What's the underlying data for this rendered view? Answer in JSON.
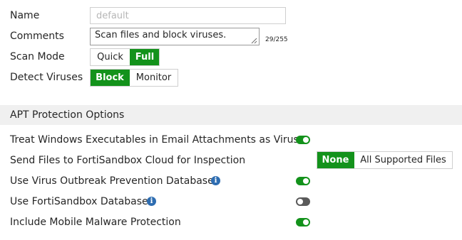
{
  "form": {
    "name_label": "Name",
    "name_placeholder": "default",
    "comments_label": "Comments",
    "comments_value": "Scan files and block viruses.",
    "comments_counter": "29/255",
    "scan_mode_label": "Scan Mode",
    "scan_mode_options": [
      "Quick",
      "Full"
    ],
    "scan_mode_selected": "Full",
    "detect_viruses_label": "Detect Viruses",
    "detect_viruses_options": [
      "Block",
      "Monitor"
    ],
    "detect_viruses_selected": "Block"
  },
  "apt": {
    "section_title": "APT Protection Options",
    "treat_exec_label": "Treat Windows Executables in Email Attachments as Viruses",
    "treat_exec_enabled": true,
    "send_sandbox_label": "Send Files to FortiSandbox Cloud for Inspection",
    "send_sandbox_options": [
      "None",
      "All Supported Files"
    ],
    "send_sandbox_selected": "None",
    "outbreak_db_label": "Use Virus Outbreak Prevention Database",
    "outbreak_db_enabled": true,
    "fortisandbox_db_label": "Use FortiSandbox Database",
    "fortisandbox_db_enabled": false,
    "mobile_malware_label": "Include Mobile Malware Protection",
    "mobile_malware_enabled": true
  },
  "icons": {
    "info_glyph": "i",
    "accent_color": "#13921b",
    "info_color": "#2e6db1"
  }
}
